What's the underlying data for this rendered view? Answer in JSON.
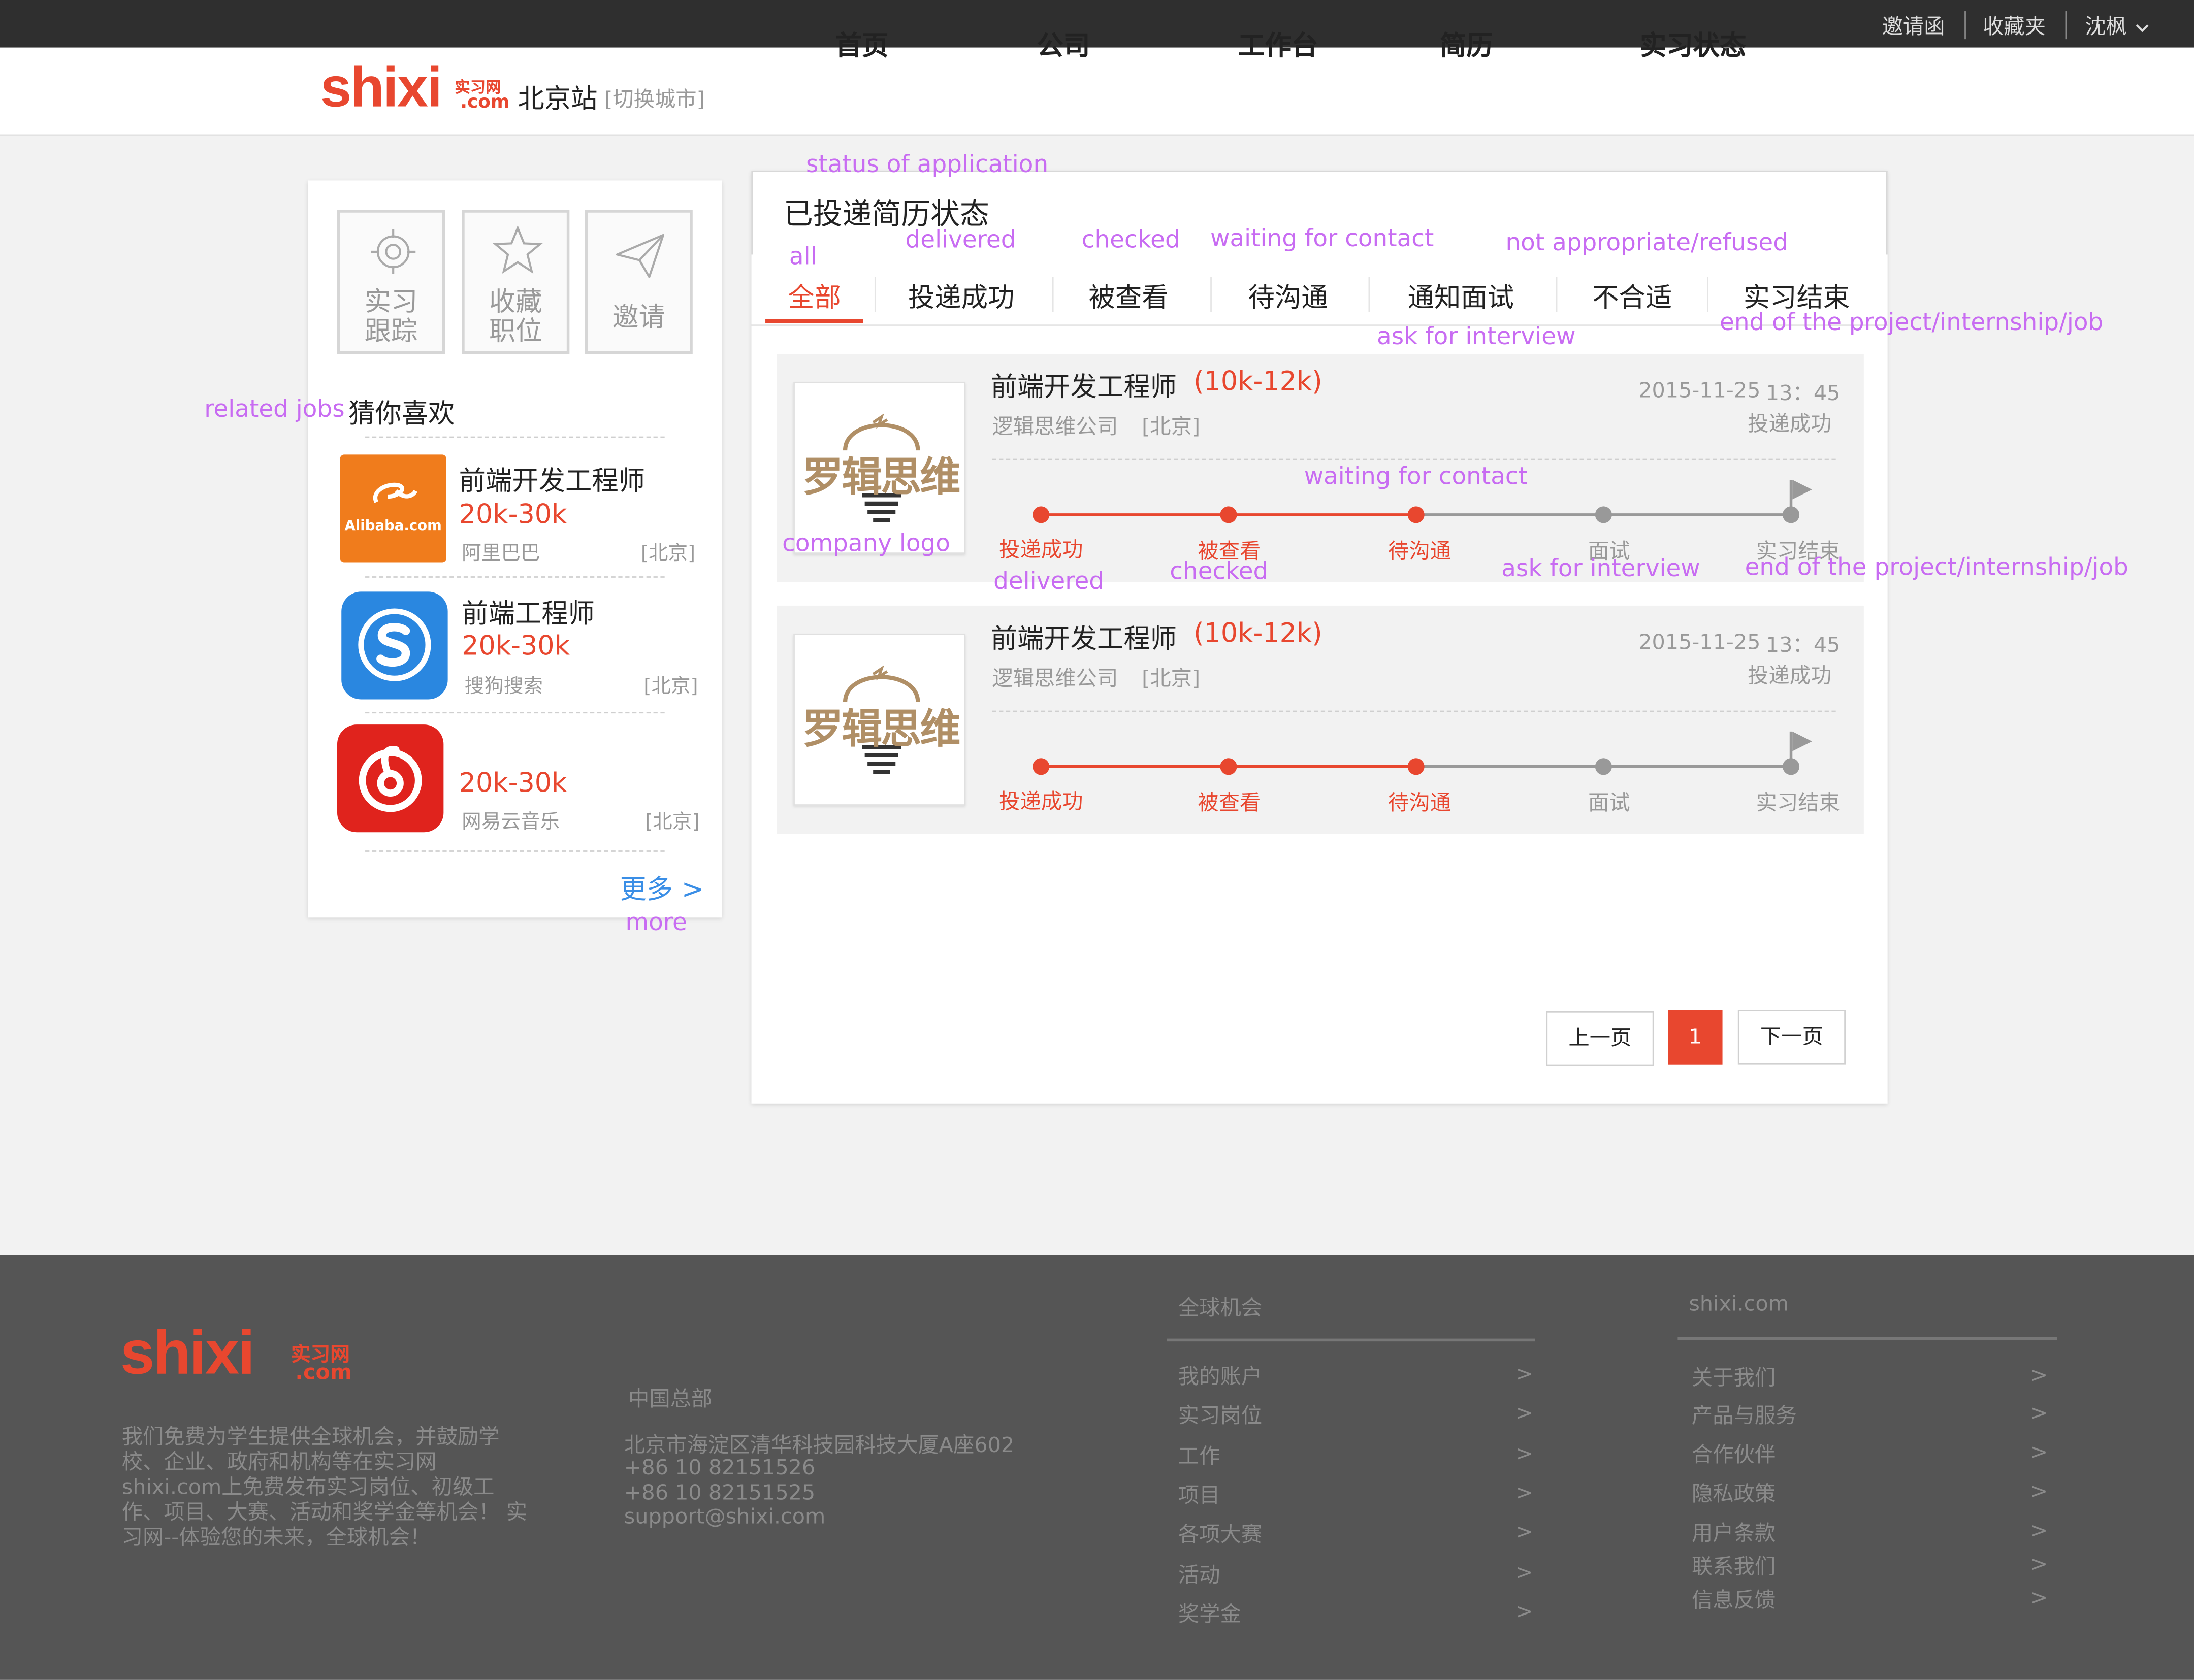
{
  "topbar": {
    "invite": "邀请函",
    "favorites": "收藏夹",
    "user": "沈枫"
  },
  "header": {
    "logo_main": "shixi",
    "logo_cn": "实习网",
    "logo_com": ".com",
    "city": "北京站",
    "switch_city": "[切换城市]",
    "nav": [
      "首页",
      "公司",
      "工作台",
      "简历",
      "实习状态"
    ]
  },
  "sidebar": {
    "quick": [
      {
        "label_1": "实习",
        "label_2": "跟踪",
        "icon": "target-icon"
      },
      {
        "label_1": "收藏",
        "label_2": "职位",
        "icon": "star-icon"
      },
      {
        "label": "邀请",
        "icon": "send-icon"
      }
    ],
    "section_title": "猜你喜欢",
    "jobs": [
      {
        "title": "前端开发工程师",
        "salary": "20k-30k",
        "company": "阿里巴巴",
        "city": "[北京]",
        "logo_text": "Alibaba.com"
      },
      {
        "title": "前端工程师",
        "salary": "20k-30k",
        "company": "搜狗搜索",
        "city": "[北京]"
      },
      {
        "title": "",
        "salary": "20k-30k",
        "company": "网易云音乐",
        "city": "[北京]"
      }
    ],
    "more": "更多 >"
  },
  "main": {
    "title": "已投递简历状态",
    "tabs": [
      "全部",
      "投递成功",
      "被查看",
      "待沟通",
      "通知面试",
      "不合适",
      "实习结束"
    ],
    "active_tab": 0,
    "applications": [
      {
        "title": "前端开发工程师",
        "salary": "(10k-12k)",
        "company": "逻辑思维公司",
        "city": "[北京]",
        "date": "2015-11-25",
        "time": "13：45",
        "status": "投递成功",
        "logo_text": "罗辑思维",
        "progress_steps_done": 3
      },
      {
        "title": "前端开发工程师",
        "salary": "(10k-12k)",
        "company": "逻辑思维公司",
        "city": "[北京]",
        "date": "2015-11-25",
        "time": "13：45",
        "status": "投递成功",
        "logo_text": "罗辑思维",
        "progress_steps_done": 3
      }
    ],
    "stages": [
      "投递成功",
      "被查看",
      "待沟通",
      "面试",
      "实习结束"
    ],
    "pagination": {
      "prev": "上一页",
      "current": "1",
      "next": "下一页"
    }
  },
  "footer": {
    "about_text": "我们免费为学生提供全球机会，并鼓励学校、企业、政府和机构等在实习网shixi.com上免费发布实习岗位、初级工作、项目、大赛、活动和奖学金等机会！ 实习网--体验您的未来，全球机会！",
    "hq_title": "中国总部",
    "hq_lines": [
      "北京市海淀区清华科技园科技大厦A座602",
      "+86 10 82151526",
      "+86 10 82151525",
      "support@shixi.com"
    ],
    "col1_title": "全球机会",
    "col1": [
      "我的账户",
      "实习岗位",
      "工作",
      "项目",
      "各项大赛",
      "活动",
      "奖学金"
    ],
    "col2_title": "shixi.com",
    "col2": [
      "关于我们",
      "产品与服务",
      "合作伙伴",
      "隐私政策",
      "用户条款",
      "联系我们",
      "信息反馈"
    ],
    "arrow": ">"
  },
  "annotations": {
    "status": "status of application",
    "all": "all",
    "delivered": "delivered",
    "checked": "checked",
    "waiting": "waiting for contact",
    "refused": "not appropriate/refused",
    "interview": "ask for interview",
    "end": "end of the project/internship/job",
    "related": "related jobs",
    "logo": "company logo",
    "more": "more"
  },
  "colors": {
    "accent": "#e8472f",
    "annotation": "#c86cf2",
    "footer_bg": "#555555",
    "topbar_bg": "#2f2f2f"
  }
}
